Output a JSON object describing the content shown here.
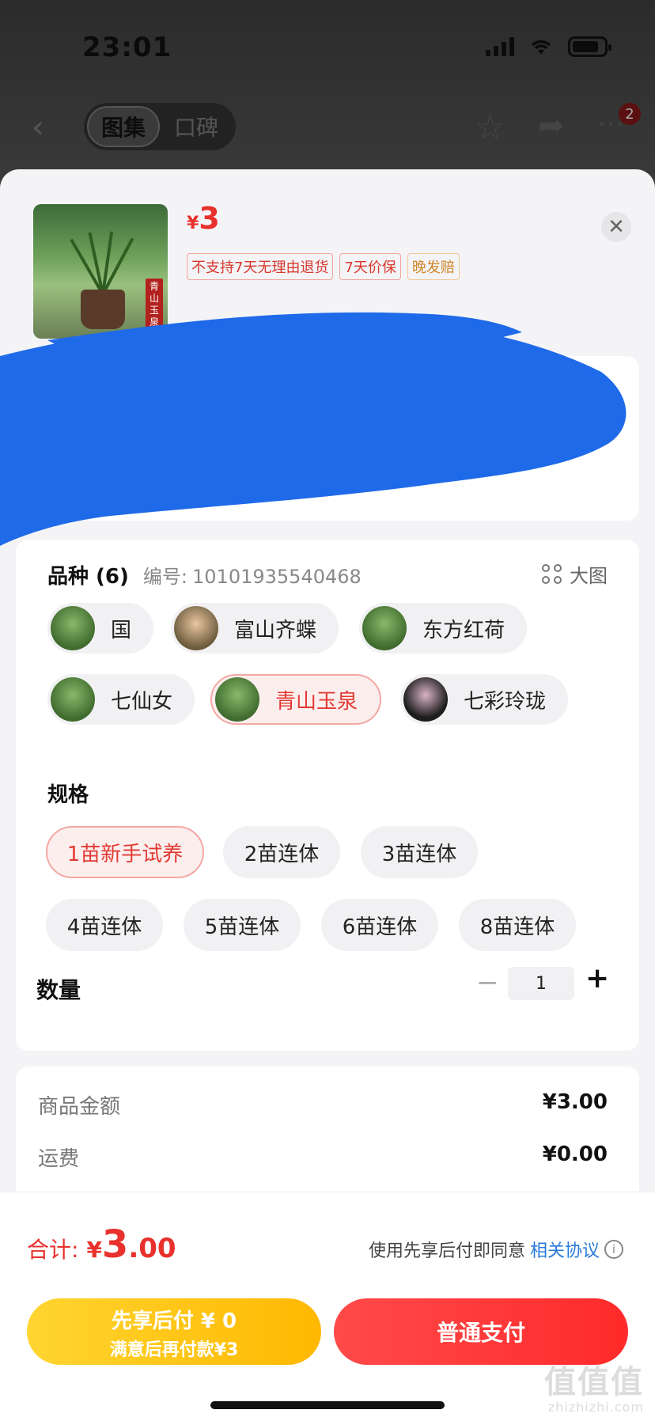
{
  "status_bar": {
    "time": "23:01"
  },
  "nav": {
    "tab_active": "图集",
    "tab_inactive": "口碑",
    "more_badge": "2"
  },
  "product": {
    "currency": "¥",
    "price": "3",
    "stamp_text": "青山玉泉",
    "tags": [
      "不支持7天无理由退货",
      "7天价保",
      "晚发赔"
    ]
  },
  "variety": {
    "title": "品种 (6)",
    "code_label": "编号:",
    "code": "10101935540468",
    "big_image_label": "大图",
    "options": [
      {
        "label": "国",
        "selected": false
      },
      {
        "label": "富山齐蝶",
        "selected": false
      },
      {
        "label": "东方红荷",
        "selected": false
      },
      {
        "label": "七仙女",
        "selected": false
      },
      {
        "label": "青山玉泉",
        "selected": true
      },
      {
        "label": "七彩玲珑",
        "selected": false
      }
    ]
  },
  "spec": {
    "title": "规格",
    "options": [
      {
        "label": "1苗新手试养",
        "selected": true
      },
      {
        "label": "2苗连体",
        "selected": false
      },
      {
        "label": "3苗连体",
        "selected": false
      },
      {
        "label": "4苗连体",
        "selected": false
      },
      {
        "label": "5苗连体",
        "selected": false
      },
      {
        "label": "6苗连体",
        "selected": false
      },
      {
        "label": "8苗连体",
        "selected": false
      }
    ]
  },
  "quantity": {
    "label": "数量",
    "value": "1",
    "minus": "−",
    "plus": "+"
  },
  "summary": {
    "goods_label": "商品金额",
    "goods_value": "¥3.00",
    "shipping_label": "运费",
    "shipping_value": "¥0.00"
  },
  "footer": {
    "total_label": "合计:",
    "total_currency": "¥",
    "total_int": "3",
    "total_dec": ".00",
    "agree_text": "使用先享后付即同意",
    "agree_link": "相关协议",
    "bnpl_line1": "先享后付 ¥ 0",
    "bnpl_line2": "满意后再付款¥3",
    "pay_label": "普通支付"
  },
  "watermark": {
    "main": "值值值",
    "sub": "zhizhizhi.com"
  },
  "colors": {
    "accent_red": "#e8312c",
    "bnpl_yellow": "#ffc21a",
    "pay_red": "#ff3333",
    "scribble_blue": "#1f6ae8"
  }
}
